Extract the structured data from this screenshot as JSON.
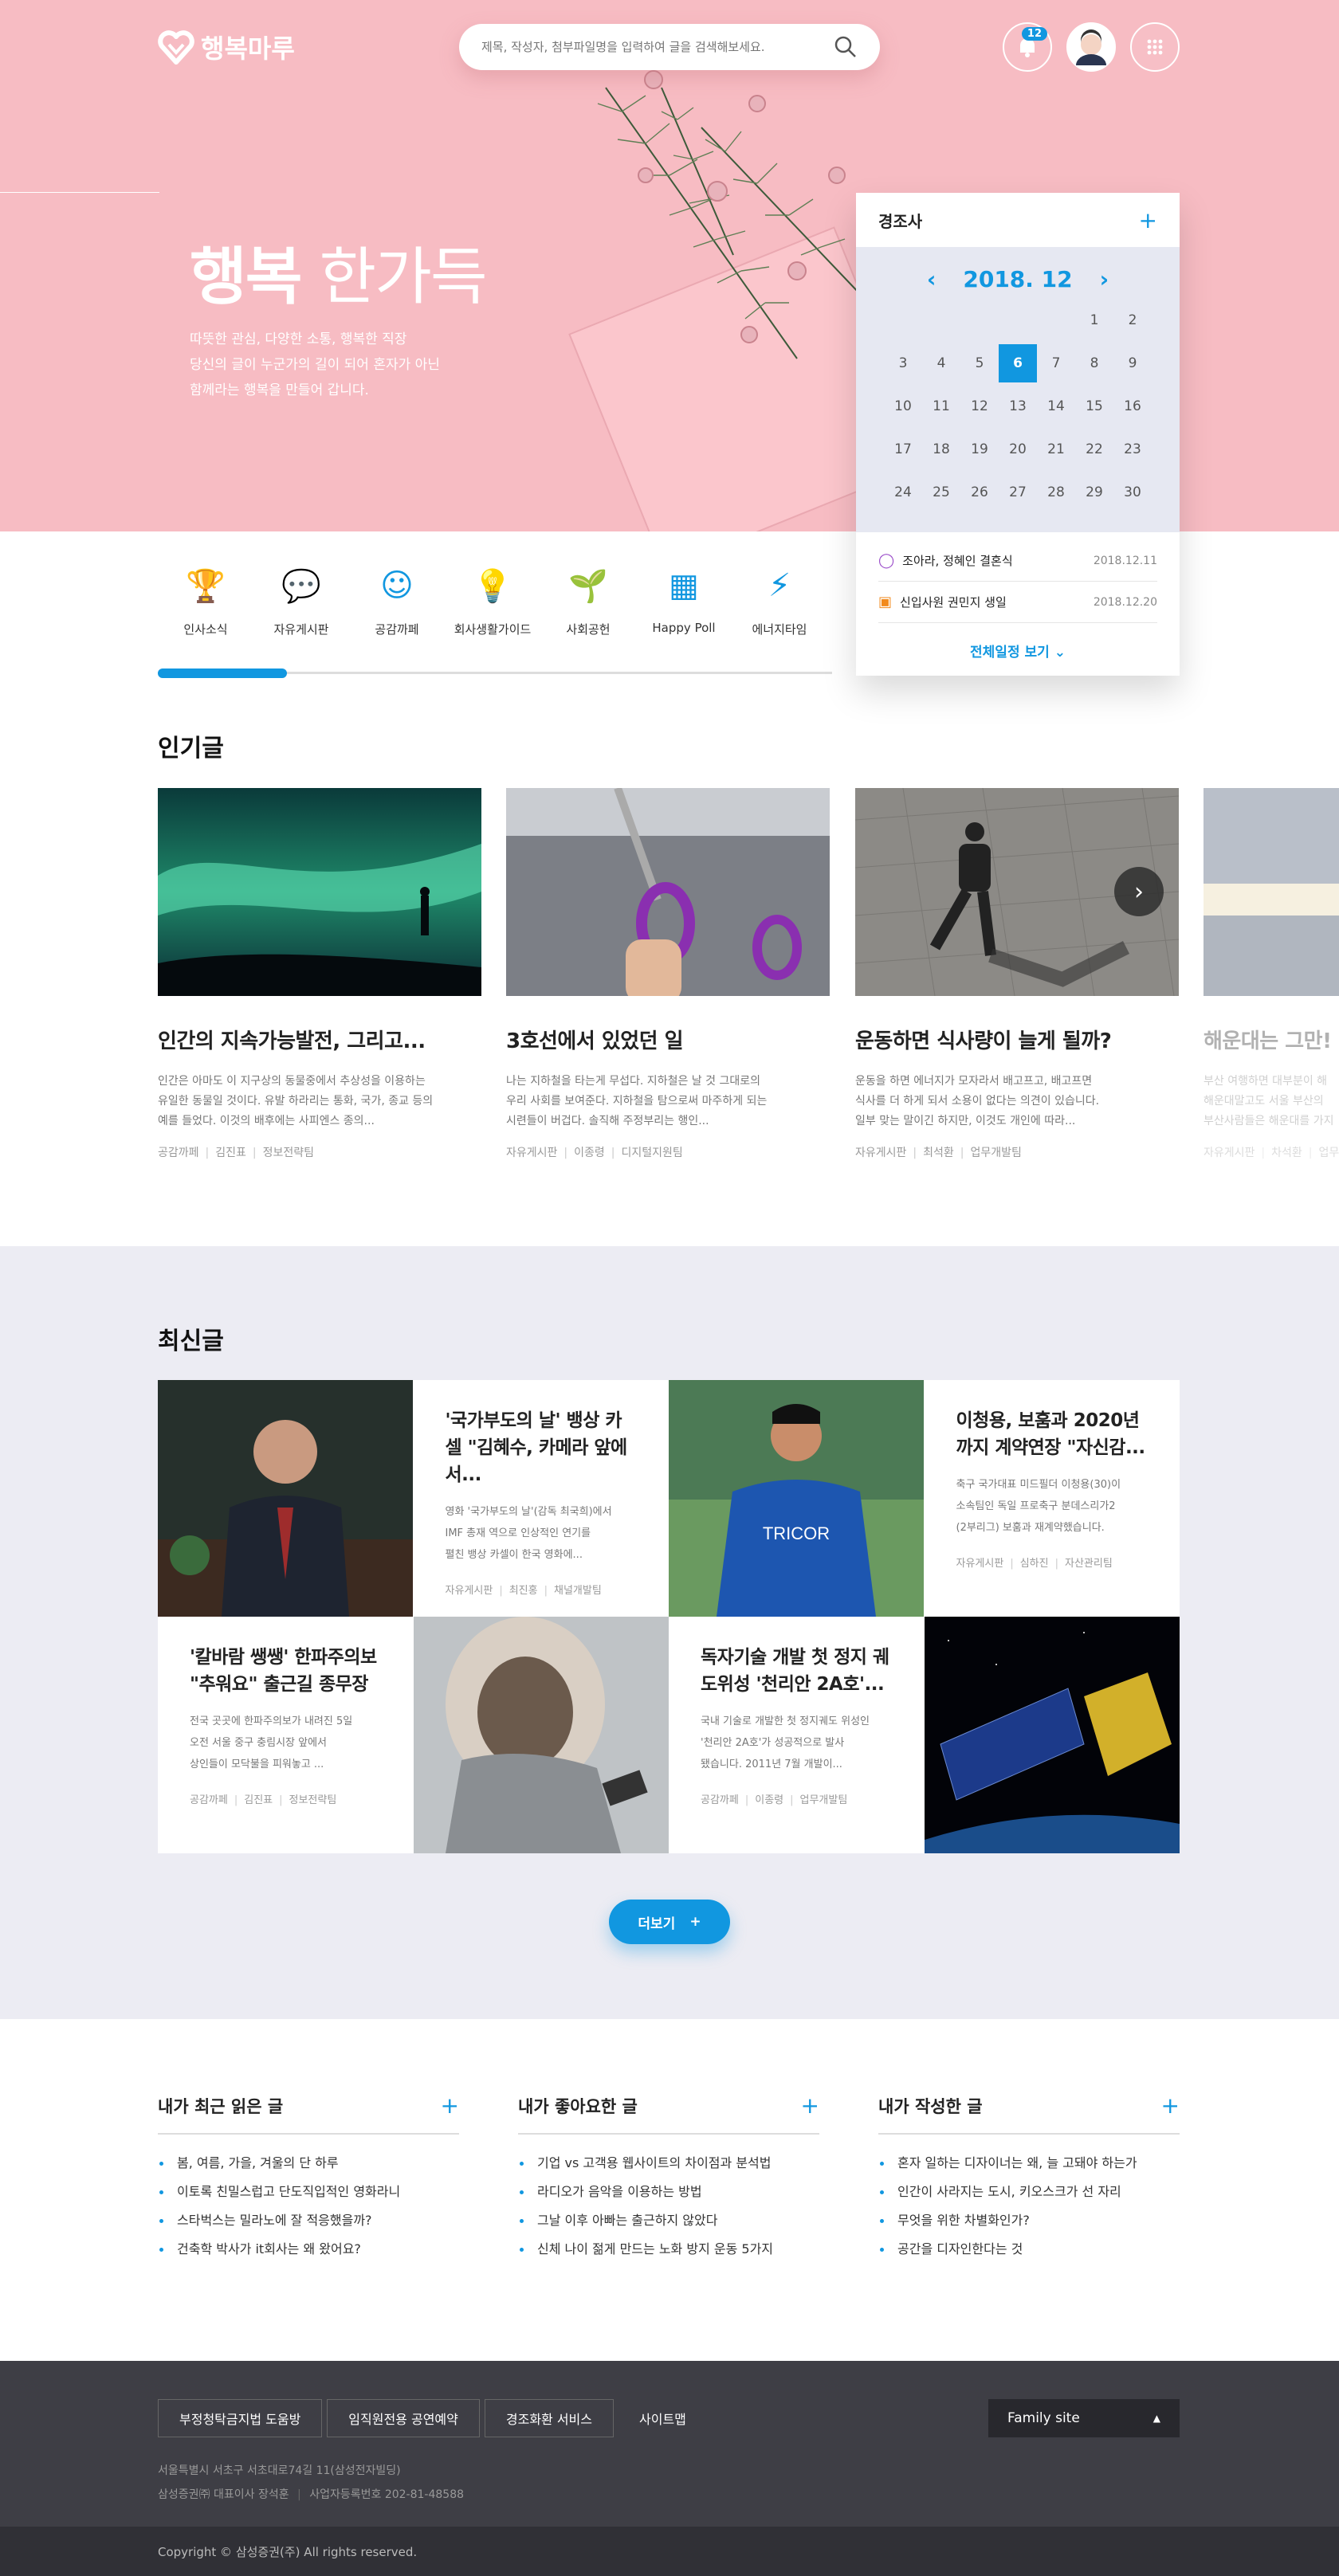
{
  "header": {
    "logo": "행복마루",
    "search_placeholder": "제목, 작성자, 첨부파일명을 입력하여 글을 검색해보세요.",
    "notification_count": "12"
  },
  "hero": {
    "title_bold": "행복",
    "title_light": "한가득",
    "desc": [
      "따뜻한 관심, 다양한 소통, 행복한 직장",
      "당신의 글이 누군가의 길이 되어 혼자가 아닌",
      "함께라는 행복을 만들어 갑니다."
    ]
  },
  "calendar": {
    "title": "경조사",
    "month": "2018. 12",
    "days": [
      "",
      "",
      "",
      "",
      "",
      "1",
      "2",
      "3",
      "4",
      "5",
      "6",
      "7",
      "8",
      "9",
      "10",
      "11",
      "12",
      "13",
      "14",
      "15",
      "16",
      "17",
      "18",
      "19",
      "20",
      "21",
      "22",
      "23",
      "24",
      "25",
      "26",
      "27",
      "28",
      "29",
      "30"
    ],
    "selected": "6",
    "events": [
      {
        "icon": "ring-icon",
        "label": "조아라, 정혜인 결혼식",
        "date": "2018.12.11"
      },
      {
        "icon": "cake-icon",
        "label": "신입사원 권민지 생일",
        "date": "2018.12.20"
      }
    ],
    "more": "전체일정 보기"
  },
  "categories": [
    "인사소식",
    "자유게시판",
    "공감까페",
    "회사생활가이드",
    "사회공헌",
    "Happy Poll",
    "에너지타임"
  ],
  "popular": {
    "title": "인기글",
    "cards": [
      {
        "title": "인간의 지속가능발전, 그리고...",
        "desc": [
          "인간은 아마도 이 지구상의 동물중에서 추상성을 이용하는",
          "유일한 동물일 것이다. 유발 하라리는 통화, 국가, 종교 등의",
          "예를 들었다. 이것의 배후에는 사피엔스 종의..."
        ],
        "meta": [
          "공감까페",
          "김진표",
          "정보전략팀"
        ]
      },
      {
        "title": "3호선에서 있었던 일",
        "desc": [
          "나는 지하철을 타는게 무섭다. 지하철은 날 것 그대로의",
          "우리 사회를 보여준다. 지하철을 탐으로써 마주하게 되는",
          "시련들이 버겁다. 솔직해 주정부리는 행인..."
        ],
        "meta": [
          "자유게시판",
          "이종령",
          "디지털지원팀"
        ]
      },
      {
        "title": "운동하면 식사량이 늘게 될까?",
        "desc": [
          "운동을 하면 에너지가 모자라서 배고프고, 배고프면",
          "식사를 더 하게 되서 소용이 없다는 의견이 있습니다.",
          "일부 맞는 말이긴 하지만, 이것도 개인에 따라..."
        ],
        "meta": [
          "자유게시판",
          "최석환",
          "업무개발팀"
        ]
      },
      {
        "title": "해운대는 그만!",
        "desc": [
          "부산 여행하면 대부분이 해",
          "해운대말고도 서울 부산의 ",
          "부산사람들은 해운대를 가지"
        ],
        "meta": [
          "자유게시판",
          "차석환",
          "업무"
        ]
      }
    ]
  },
  "latest": {
    "title": "최신글",
    "items": [
      {
        "title": "'국가부도의 날' 뱅상 카셀 \"김혜수, 카메라 앞에서...",
        "desc": [
          "영화 '국가부도의 날'(감독 최국희)에서",
          "IMF 총재 역으로 인상적인 연기를",
          "펼친 뱅상 카셀이 한국 영화에..."
        ],
        "meta": [
          "자유게시판",
          "최진홍",
          "채널개발팀"
        ]
      },
      {
        "title": "이청용, 보훔과 2020년까지 계약연장 \"자신감...",
        "desc": [
          "축구 국가대표 미드필더 이청용(30)이",
          "소속팀인 독일 프로축구 분데스리가2",
          "(2부리그) 보훔과 재계약했습니다."
        ],
        "meta": [
          "자유게시판",
          "심하진",
          "자산관리팀"
        ]
      },
      {
        "title": "'칼바람 쌩쌩' 한파주의보 \"추워요\" 출근길 종무장",
        "desc": [
          "전국 곳곳에 한파주의보가 내려진 5일",
          "오전 서울 중구 충림시장 앞에서",
          "상인들이 모닥불을 피워놓고 ..."
        ],
        "meta": [
          "공감까페",
          "김진표",
          "정보전략팀"
        ]
      },
      {
        "title": "독자기술 개발 첫 정지 궤도위성 '천리안 2A호'...",
        "desc": [
          "국내 기술로 개발한 첫 정지궤도 위성인",
          "'천리안 2A호'가 성공적으로 발사",
          "됐습니다. 2011년 7월 개발이..."
        ],
        "meta": [
          "공감까페",
          "이종령",
          "업무개발팀"
        ]
      }
    ],
    "more": "더보기"
  },
  "lists": [
    {
      "title": "내가 최근 읽은 글",
      "items": [
        "봄, 여름, 가을, 겨울의 단 하루",
        "이토록 친밀스럽고 단도직입적인 영화라니",
        "스타벅스는 밀라노에 잘 적응했을까?",
        "건축학 박사가 it회사는 왜 왔어요?"
      ]
    },
    {
      "title": "내가 좋아요한 글",
      "items": [
        "기업 vs 고객용 웹사이트의 차이점과 분석법",
        "라디오가 음악을 이용하는 방법",
        "그날 이후 아빠는 출근하지 않았다",
        "신체 나이 젊게 만드는 노화 방지 운동 5가지"
      ]
    },
    {
      "title": "내가 작성한 글",
      "items": [
        "혼자 일하는 디자이너는 왜, 늘 고돼야 하는가",
        "인간이 사라지는 도시, 키오스크가 선 자리",
        "무엇을 위한 차별화인가?",
        "공간을 디자인한다는 것"
      ]
    }
  ],
  "footer": {
    "buttons": [
      "부정청탁금지법 도움방",
      "임직원전용 공연예약",
      "경조화환 서비스",
      "사이트맵"
    ],
    "family": "Family site",
    "address": "서울특별시 서초구 서초대로74길 11(삼성전자빌딩)",
    "company": "삼성증권㈜ 대표이사 장석훈",
    "bizno": "사업자등록번호 202-81-48588",
    "copyright": "Copyright © 삼성증권(주) All rights reserved."
  },
  "colors": {
    "accent": "#1197e0",
    "hero_bg": "#f7bcc3",
    "latest_bg": "#ececf3",
    "footer_bg": "#3e3e45"
  }
}
